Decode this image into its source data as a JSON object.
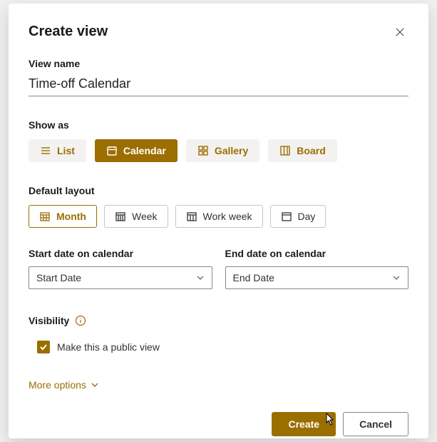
{
  "dialog": {
    "title": "Create view"
  },
  "viewName": {
    "label": "View name",
    "value": "Time-off Calendar"
  },
  "showAs": {
    "label": "Show as",
    "options": {
      "list": "List",
      "calendar": "Calendar",
      "gallery": "Gallery",
      "board": "Board"
    },
    "selected": "calendar"
  },
  "defaultLayout": {
    "label": "Default layout",
    "options": {
      "month": "Month",
      "week": "Week",
      "workweek": "Work week",
      "day": "Day"
    },
    "selected": "month"
  },
  "startDate": {
    "label": "Start date on calendar",
    "value": "Start Date"
  },
  "endDate": {
    "label": "End date on calendar",
    "value": "End Date"
  },
  "visibility": {
    "label": "Visibility",
    "checkbox": "Make this a public view",
    "checked": true
  },
  "moreOptions": "More options",
  "actions": {
    "create": "Create",
    "cancel": "Cancel"
  }
}
